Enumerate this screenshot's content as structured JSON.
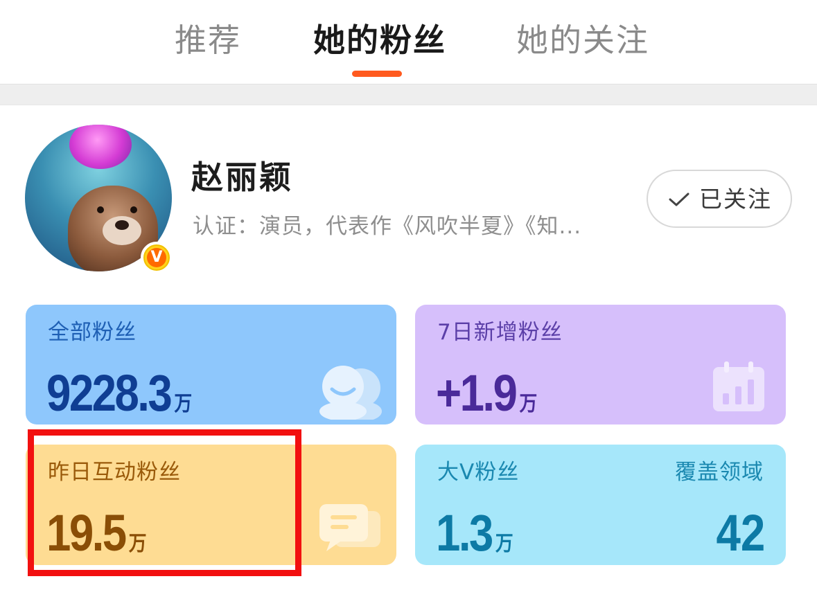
{
  "tabs": [
    {
      "label": "推荐",
      "active": false
    },
    {
      "label": "她的粉丝",
      "active": true
    },
    {
      "label": "她的关注",
      "active": false
    }
  ],
  "accent_color": "#ff5a1f",
  "profile": {
    "name": "赵丽颖",
    "verification": "认证：演员，代表作《风吹半夏》《知...",
    "badge_text": "V",
    "follow_button": "已关注"
  },
  "stats": {
    "all_fans": {
      "label": "全部粉丝",
      "value": "9228.3",
      "unit": "万",
      "icon": "users-icon",
      "color": "#8ec7fc"
    },
    "new_7d": {
      "label": "7日新增粉丝",
      "value": "+1.9",
      "unit": "万",
      "icon": "calendar-chart-icon",
      "color": "#d6bffb"
    },
    "interactive_yesterday": {
      "label": "昨日互动粉丝",
      "value": "19.5",
      "unit": "万",
      "icon": "chat-bubble-icon",
      "color": "#fedc93",
      "highlighted": true
    },
    "big_v": {
      "label": "大V粉丝",
      "value": "1.3",
      "unit": "万",
      "domain_label": "覆盖领域",
      "domain_value": "42",
      "color": "#a6e7fa"
    }
  },
  "highlight_color": "#f21010"
}
